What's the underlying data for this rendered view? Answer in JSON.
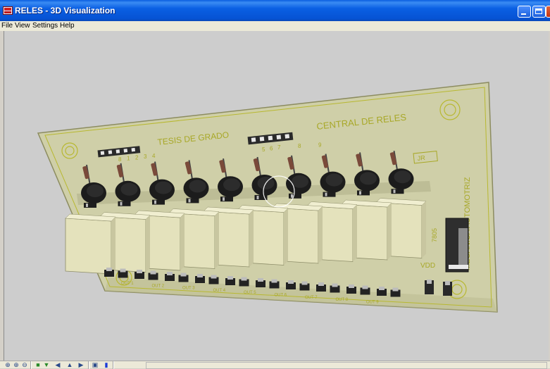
{
  "window": {
    "title": "RELES - 3D Visualization"
  },
  "menu": [
    "File",
    "View",
    "Settings",
    "Help"
  ],
  "board": {
    "silkscreen_left": "TESIS DE GRADO",
    "silkscreen_center": "CENTRAL DE RELES",
    "silkscreen_vertical": "MECANICA AUTOMOTRIZ",
    "regulator_label": "7805",
    "vdd_label": "VDD",
    "jr_label": "JR",
    "header_left_pins": [
      "8",
      "1",
      "2",
      "3",
      "4"
    ],
    "header_center_pins": [
      "5",
      "6",
      "7",
      "8",
      "9"
    ],
    "output_labels": [
      "OUT 1",
      "OUT 2",
      "OUT 3",
      "OUT 4",
      "OUT 5",
      "OUT 6",
      "OUT 7",
      "OUT 8",
      "OUT 9"
    ],
    "relay_count": 10
  },
  "toolbar": {
    "buttons": [
      "pan-icon",
      "zoom-in-icon",
      "zoom-out-icon",
      "view-top-icon",
      "view-bottom-icon",
      "rotate-left-icon",
      "flip-icon",
      "rotate-right-icon",
      "copy-icon",
      "color-icon"
    ]
  },
  "colors": {
    "board": "#cfcfa8",
    "silkscreen": "#b8b830",
    "relay": "#e2e0b8"
  }
}
